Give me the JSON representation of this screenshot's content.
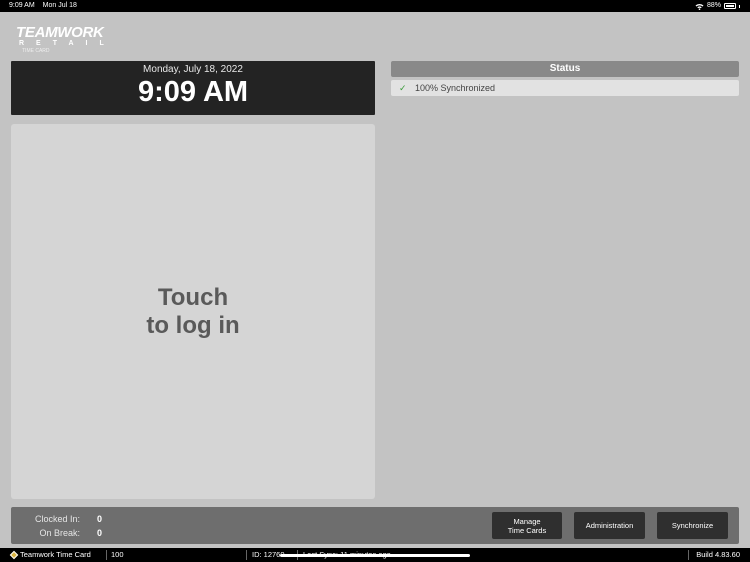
{
  "status_bar": {
    "time": "9:09 AM",
    "date": "Mon Jul 18",
    "battery": "88%"
  },
  "logo": {
    "main": "TEAMWORK",
    "sub": "RETAIL",
    "tag": "TIME CARD"
  },
  "clock": {
    "date": "Monday, July 18, 2022",
    "time": "9:09 AM"
  },
  "login": {
    "label": "Touch\nto log in"
  },
  "status": {
    "header": "Status",
    "items": [
      {
        "icon": "check-icon",
        "text": "100% Synchronized"
      }
    ]
  },
  "counts": {
    "clocked_in_label": "Clocked In:",
    "clocked_in_value": "0",
    "on_break_label": "On Break:",
    "on_break_value": "0"
  },
  "buttons": {
    "manage": "Manage\nTime Cards",
    "admin": "Administration",
    "sync": "Synchronize"
  },
  "footer": {
    "app_name": "Teamwork Time Card",
    "store": "100",
    "id": "ID: 12760",
    "last_sync": "Last Sync: 11 minutes ago",
    "build": "Build 4.83.60"
  },
  "colors": {
    "background": "#c3c3c3",
    "dark_panel": "#232323",
    "status_header": "#898989",
    "check": "#3b9c3b"
  }
}
